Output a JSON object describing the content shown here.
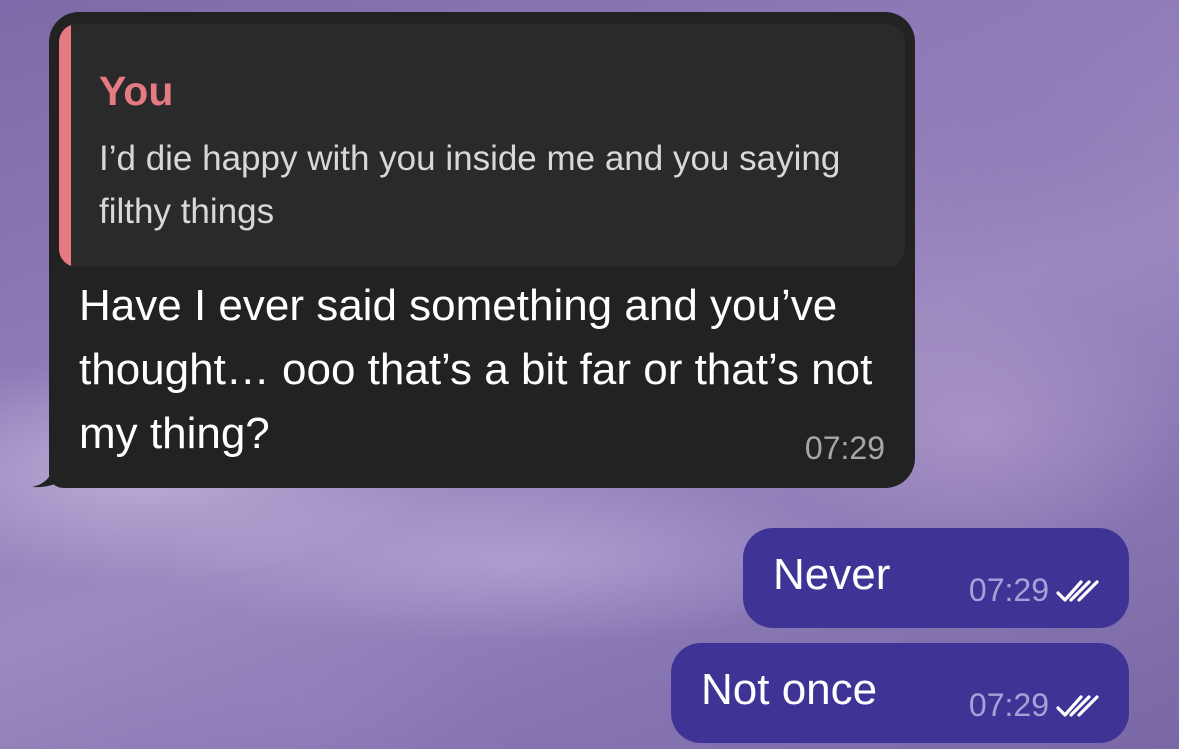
{
  "colors": {
    "incoming_bubble": "#222222",
    "reply_block": "#2a2a2a",
    "reply_accent": "#e57a82",
    "outgoing_bubble": "#3f3496",
    "time_incoming": "#a7a7a7",
    "time_outgoing": "#a8a0d8"
  },
  "messages": [
    {
      "direction": "incoming",
      "reply": {
        "author": "You",
        "text": "I’d die happy with you inside me and you saying filthy things"
      },
      "text": "Have I ever said something and you’ve thought… ooo that’s a bit far or that’s not my thing?",
      "time": "07:29"
    },
    {
      "direction": "outgoing",
      "text": "Never",
      "time": "07:29",
      "status_icon": "double-check-icon"
    },
    {
      "direction": "outgoing",
      "text": "Not once",
      "time": "07:29",
      "status_icon": "double-check-icon"
    }
  ]
}
